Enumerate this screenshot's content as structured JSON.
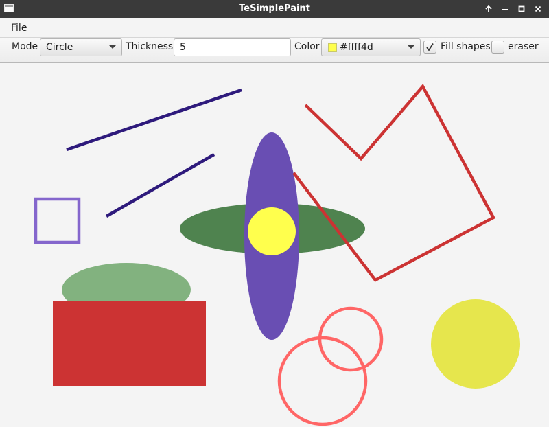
{
  "window": {
    "title": "TeSimplePaint"
  },
  "menu": {
    "items": [
      "File"
    ]
  },
  "toolbar": {
    "mode_label": "Mode",
    "mode_value": "Circle",
    "thickness_label": "Thickness",
    "thickness_value": "5",
    "color_label": "Color",
    "color_value": "#ffff4d",
    "color_swatch": "#ffff4d",
    "fill_label": "Fill shapes",
    "fill_checked": true,
    "eraser_label": "eraser",
    "eraser_checked": false
  },
  "colors": {
    "navy": "#2e1a7c",
    "purple_outline": "#8466cc",
    "green_light": "#82b27f",
    "red_fill": "#cc3333",
    "green_dark": "#4f834f",
    "violet": "#694eb3",
    "yellow": "#ffff4d",
    "red_line": "#cc3333",
    "salmon": "#ff6666",
    "yellow_dark": "#e6e64d"
  }
}
